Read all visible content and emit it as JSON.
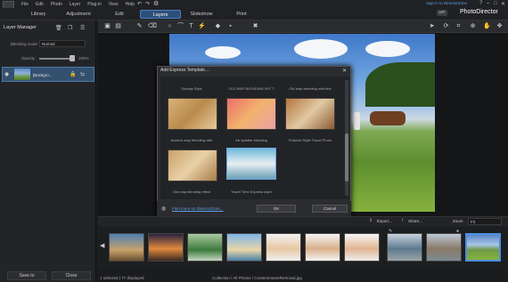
{
  "menu": [
    "File",
    "Edit",
    "Photo",
    "Layer",
    "Plug-in",
    "View",
    "Help"
  ],
  "header": {
    "signin": "Sign in to DirectorZone",
    "app_badge": "APP",
    "app_title": "PhotoDirector",
    "window_controls": [
      "?",
      "–",
      "□",
      "✕"
    ]
  },
  "mode_tabs": [
    "Library",
    "Adjustment",
    "Edit",
    "Layers",
    "Slideshow",
    "Print"
  ],
  "left_panel": {
    "title": "Layer Manager",
    "blending_label": "Blending mode",
    "blending_value": "Normal",
    "opacity_label": "Opacity",
    "opacity_value": "100%",
    "opacity_level": 1.0,
    "layer_name": "[Backgro...",
    "save_label": "Save to",
    "close_label": "Close"
  },
  "dialog": {
    "title": "Add Express Template...",
    "close": "✕",
    "template_captions": [
      "Sunday Style",
      "OLD MAP BLENDING WIT T",
      "Old map blending with text",
      "Ancient map blending with",
      "Ink splatter blending",
      "Polaroid Style Travel Photo",
      "Old map blending effect",
      "Travel Time Express layer"
    ],
    "find_more": "Find more on DirectorZone...",
    "ok": "OK",
    "cancel": "Cancel"
  },
  "filmbar": {
    "export": "Export...",
    "share": "Share...",
    "zoom_label": "Zoom",
    "zoom_value": "Fit"
  },
  "status": {
    "selection": "1 selected  |  77 displayed",
    "path": "Collection / All Photos / ContentAwareRemoval.jpg"
  },
  "colors": {
    "accent": "#2e4f7a",
    "link": "#5fa0e6",
    "panel": "#232427"
  }
}
